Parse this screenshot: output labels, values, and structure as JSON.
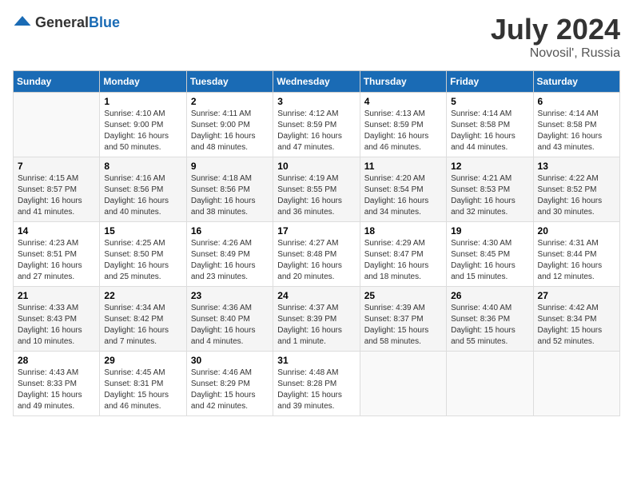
{
  "header": {
    "logo_general": "General",
    "logo_blue": "Blue",
    "title": "July 2024",
    "location": "Novosil', Russia"
  },
  "days_of_week": [
    "Sunday",
    "Monday",
    "Tuesday",
    "Wednesday",
    "Thursday",
    "Friday",
    "Saturday"
  ],
  "weeks": [
    [
      {
        "num": "",
        "info": ""
      },
      {
        "num": "1",
        "info": "Sunrise: 4:10 AM\nSunset: 9:00 PM\nDaylight: 16 hours\nand 50 minutes."
      },
      {
        "num": "2",
        "info": "Sunrise: 4:11 AM\nSunset: 9:00 PM\nDaylight: 16 hours\nand 48 minutes."
      },
      {
        "num": "3",
        "info": "Sunrise: 4:12 AM\nSunset: 8:59 PM\nDaylight: 16 hours\nand 47 minutes."
      },
      {
        "num": "4",
        "info": "Sunrise: 4:13 AM\nSunset: 8:59 PM\nDaylight: 16 hours\nand 46 minutes."
      },
      {
        "num": "5",
        "info": "Sunrise: 4:14 AM\nSunset: 8:58 PM\nDaylight: 16 hours\nand 44 minutes."
      },
      {
        "num": "6",
        "info": "Sunrise: 4:14 AM\nSunset: 8:58 PM\nDaylight: 16 hours\nand 43 minutes."
      }
    ],
    [
      {
        "num": "7",
        "info": "Sunrise: 4:15 AM\nSunset: 8:57 PM\nDaylight: 16 hours\nand 41 minutes."
      },
      {
        "num": "8",
        "info": "Sunrise: 4:16 AM\nSunset: 8:56 PM\nDaylight: 16 hours\nand 40 minutes."
      },
      {
        "num": "9",
        "info": "Sunrise: 4:18 AM\nSunset: 8:56 PM\nDaylight: 16 hours\nand 38 minutes."
      },
      {
        "num": "10",
        "info": "Sunrise: 4:19 AM\nSunset: 8:55 PM\nDaylight: 16 hours\nand 36 minutes."
      },
      {
        "num": "11",
        "info": "Sunrise: 4:20 AM\nSunset: 8:54 PM\nDaylight: 16 hours\nand 34 minutes."
      },
      {
        "num": "12",
        "info": "Sunrise: 4:21 AM\nSunset: 8:53 PM\nDaylight: 16 hours\nand 32 minutes."
      },
      {
        "num": "13",
        "info": "Sunrise: 4:22 AM\nSunset: 8:52 PM\nDaylight: 16 hours\nand 30 minutes."
      }
    ],
    [
      {
        "num": "14",
        "info": "Sunrise: 4:23 AM\nSunset: 8:51 PM\nDaylight: 16 hours\nand 27 minutes."
      },
      {
        "num": "15",
        "info": "Sunrise: 4:25 AM\nSunset: 8:50 PM\nDaylight: 16 hours\nand 25 minutes."
      },
      {
        "num": "16",
        "info": "Sunrise: 4:26 AM\nSunset: 8:49 PM\nDaylight: 16 hours\nand 23 minutes."
      },
      {
        "num": "17",
        "info": "Sunrise: 4:27 AM\nSunset: 8:48 PM\nDaylight: 16 hours\nand 20 minutes."
      },
      {
        "num": "18",
        "info": "Sunrise: 4:29 AM\nSunset: 8:47 PM\nDaylight: 16 hours\nand 18 minutes."
      },
      {
        "num": "19",
        "info": "Sunrise: 4:30 AM\nSunset: 8:45 PM\nDaylight: 16 hours\nand 15 minutes."
      },
      {
        "num": "20",
        "info": "Sunrise: 4:31 AM\nSunset: 8:44 PM\nDaylight: 16 hours\nand 12 minutes."
      }
    ],
    [
      {
        "num": "21",
        "info": "Sunrise: 4:33 AM\nSunset: 8:43 PM\nDaylight: 16 hours\nand 10 minutes."
      },
      {
        "num": "22",
        "info": "Sunrise: 4:34 AM\nSunset: 8:42 PM\nDaylight: 16 hours\nand 7 minutes."
      },
      {
        "num": "23",
        "info": "Sunrise: 4:36 AM\nSunset: 8:40 PM\nDaylight: 16 hours\nand 4 minutes."
      },
      {
        "num": "24",
        "info": "Sunrise: 4:37 AM\nSunset: 8:39 PM\nDaylight: 16 hours\nand 1 minute."
      },
      {
        "num": "25",
        "info": "Sunrise: 4:39 AM\nSunset: 8:37 PM\nDaylight: 15 hours\nand 58 minutes."
      },
      {
        "num": "26",
        "info": "Sunrise: 4:40 AM\nSunset: 8:36 PM\nDaylight: 15 hours\nand 55 minutes."
      },
      {
        "num": "27",
        "info": "Sunrise: 4:42 AM\nSunset: 8:34 PM\nDaylight: 15 hours\nand 52 minutes."
      }
    ],
    [
      {
        "num": "28",
        "info": "Sunrise: 4:43 AM\nSunset: 8:33 PM\nDaylight: 15 hours\nand 49 minutes."
      },
      {
        "num": "29",
        "info": "Sunrise: 4:45 AM\nSunset: 8:31 PM\nDaylight: 15 hours\nand 46 minutes."
      },
      {
        "num": "30",
        "info": "Sunrise: 4:46 AM\nSunset: 8:29 PM\nDaylight: 15 hours\nand 42 minutes."
      },
      {
        "num": "31",
        "info": "Sunrise: 4:48 AM\nSunset: 8:28 PM\nDaylight: 15 hours\nand 39 minutes."
      },
      {
        "num": "",
        "info": ""
      },
      {
        "num": "",
        "info": ""
      },
      {
        "num": "",
        "info": ""
      }
    ]
  ]
}
